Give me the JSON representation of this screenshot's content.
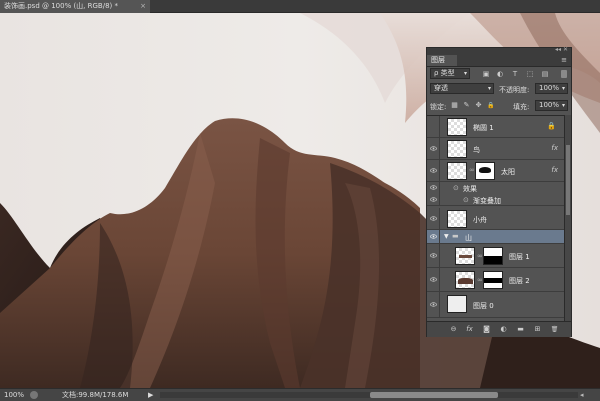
{
  "document_tab": {
    "title": "装饰画.psd @ 100% (山, RGB/8) *",
    "close": "×"
  },
  "status_bar": {
    "zoom": "100%",
    "doc_info": "文档:99.8M/178.6M",
    "arrow": "▶",
    "right_arrow": "◂"
  },
  "layers_panel": {
    "title": "图层",
    "menu": "≡",
    "collapse": "◂◂ ✕",
    "filter_type": "ρ 类型",
    "filter_icons": [
      "image-filter-icon",
      "adjustment-filter-icon",
      "type-filter-icon",
      "shape-filter-icon",
      "smart-object-filter-icon"
    ],
    "filter_icon_glyphs": [
      "▣",
      "◐",
      "T",
      "⬚",
      "▤"
    ],
    "blend_mode": "穿透",
    "opacity_label": "不透明度:",
    "opacity_value": "100%",
    "lock_label": "锁定:",
    "lock_glyphs": [
      "▦",
      "✎",
      "✥",
      "🔒"
    ],
    "fill_label": "填充:",
    "fill_value": "100%",
    "layers": [
      {
        "name": "椭圆 1",
        "visible": false,
        "fx": "",
        "locked": true
      },
      {
        "name": "鸟",
        "visible": true,
        "fx": "fx"
      },
      {
        "name": "太阳",
        "visible": true,
        "fx": "fx"
      },
      {
        "name": "效果",
        "visible": true,
        "fx": ""
      },
      {
        "name": "渐变叠加",
        "visible": true,
        "fx": ""
      },
      {
        "name": "小舟",
        "visible": true,
        "fx": ""
      },
      {
        "name": "山",
        "visible": true,
        "fx": "",
        "group": true,
        "selected": true
      },
      {
        "name": "图层 1",
        "visible": true,
        "fx": ""
      },
      {
        "name": "图层 2",
        "visible": true,
        "fx": ""
      },
      {
        "name": "图层 0",
        "visible": true,
        "fx": ""
      }
    ],
    "bottom_glyphs": [
      "⊖",
      "fx",
      "◙",
      "◐",
      "▬",
      "⊞",
      "🗑"
    ]
  },
  "colors": {
    "accent_selected": "#6a7a8e",
    "mountain_main": "#6e4a3b",
    "mountain_dark": "#2e1f1a",
    "sky": "#eae6e3"
  }
}
